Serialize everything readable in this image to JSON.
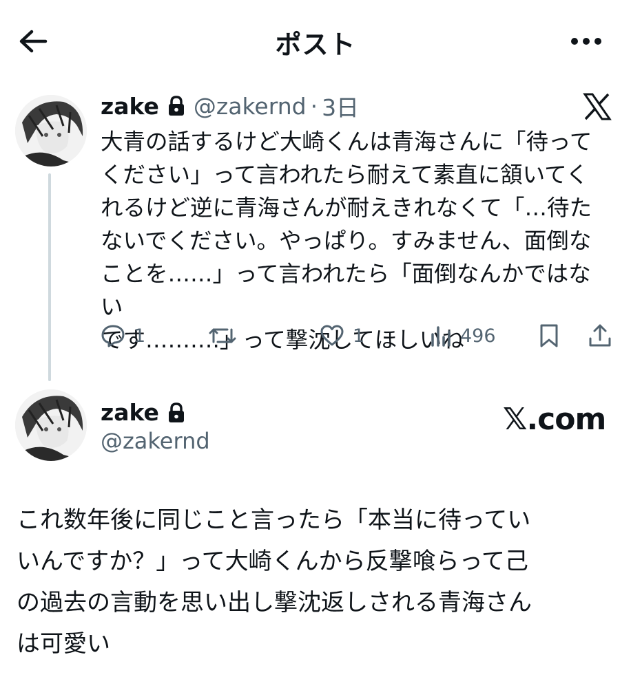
{
  "header": {
    "title": "ポスト"
  },
  "post1": {
    "display_name": "zake",
    "handle": "@zakernd",
    "separator": "·",
    "time": "3日",
    "body": "大青の話するけど大崎くんは青海さんに「待って\nください」って言われたら耐えて素直に頷いてく\nれるけど逆に青海さんが耐えきれなくて「…待た\nないでください。やっぱり。すみません、面倒な\nことを……」って言われたら「面倒なんかではない\nです……….」って撃沈してほしいね",
    "replies": "1",
    "reposts": "",
    "likes": "1",
    "views": "496"
  },
  "post2": {
    "display_name": "zake",
    "handle": "@zakernd",
    "brand": "𝕏.com",
    "body": "これ数年後に同じこと言ったら「本当に待ってい\nいんですか？」って大崎くんから反撃喰らって己\nの過去の言動を思い出し撃沈返しされる青海さん\nは可愛い"
  },
  "icons": {
    "back": "arrow-left-icon",
    "more": "more-horizontal-icon",
    "lock": "lock-icon",
    "x_logo": "x-logo-icon",
    "reply": "reply-icon",
    "repost": "repost-icon",
    "like": "heart-icon",
    "views": "views-icon",
    "bookmark": "bookmark-icon",
    "share": "share-icon"
  },
  "colors": {
    "text": "#0f1419",
    "muted": "#536471",
    "thread_line": "#cfd9de",
    "background": "#ffffff"
  }
}
